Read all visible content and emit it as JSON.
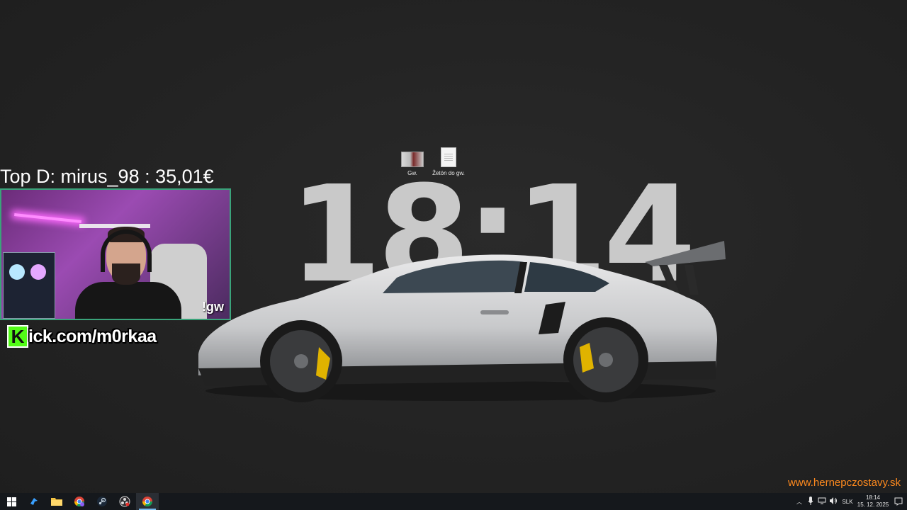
{
  "desktop": {
    "icons": [
      {
        "label": "Gw.",
        "icon": "image-file-icon"
      },
      {
        "label": "Žetón do gw.",
        "icon": "text-file-icon"
      }
    ],
    "wallpaper_clock": "18:14"
  },
  "overlay": {
    "top_donation": "Top D: mirus_98 : 35,01€",
    "webcam_command": "!gw",
    "kick_badge": "K",
    "kick_text": "ick.com/m0rkaa",
    "website": "www.hernepczostavy.sk",
    "colors": {
      "kick_green": "#53fc18",
      "website_orange": "#ff8a1e",
      "webcam_border": "#3aa37a"
    }
  },
  "taskbar": {
    "apps": [
      {
        "name": "start",
        "icon": "windows-icon"
      },
      {
        "name": "search",
        "icon": "bird-app-icon"
      },
      {
        "name": "file-explorer",
        "icon": "folder-icon"
      },
      {
        "name": "chrome-profile",
        "icon": "chrome-icon"
      },
      {
        "name": "steam",
        "icon": "steam-icon"
      },
      {
        "name": "obs",
        "icon": "obs-icon"
      },
      {
        "name": "chrome",
        "icon": "chrome-icon"
      }
    ],
    "tray": {
      "language": "SLK",
      "time": "18:14",
      "date": "15. 12. 2025"
    }
  }
}
